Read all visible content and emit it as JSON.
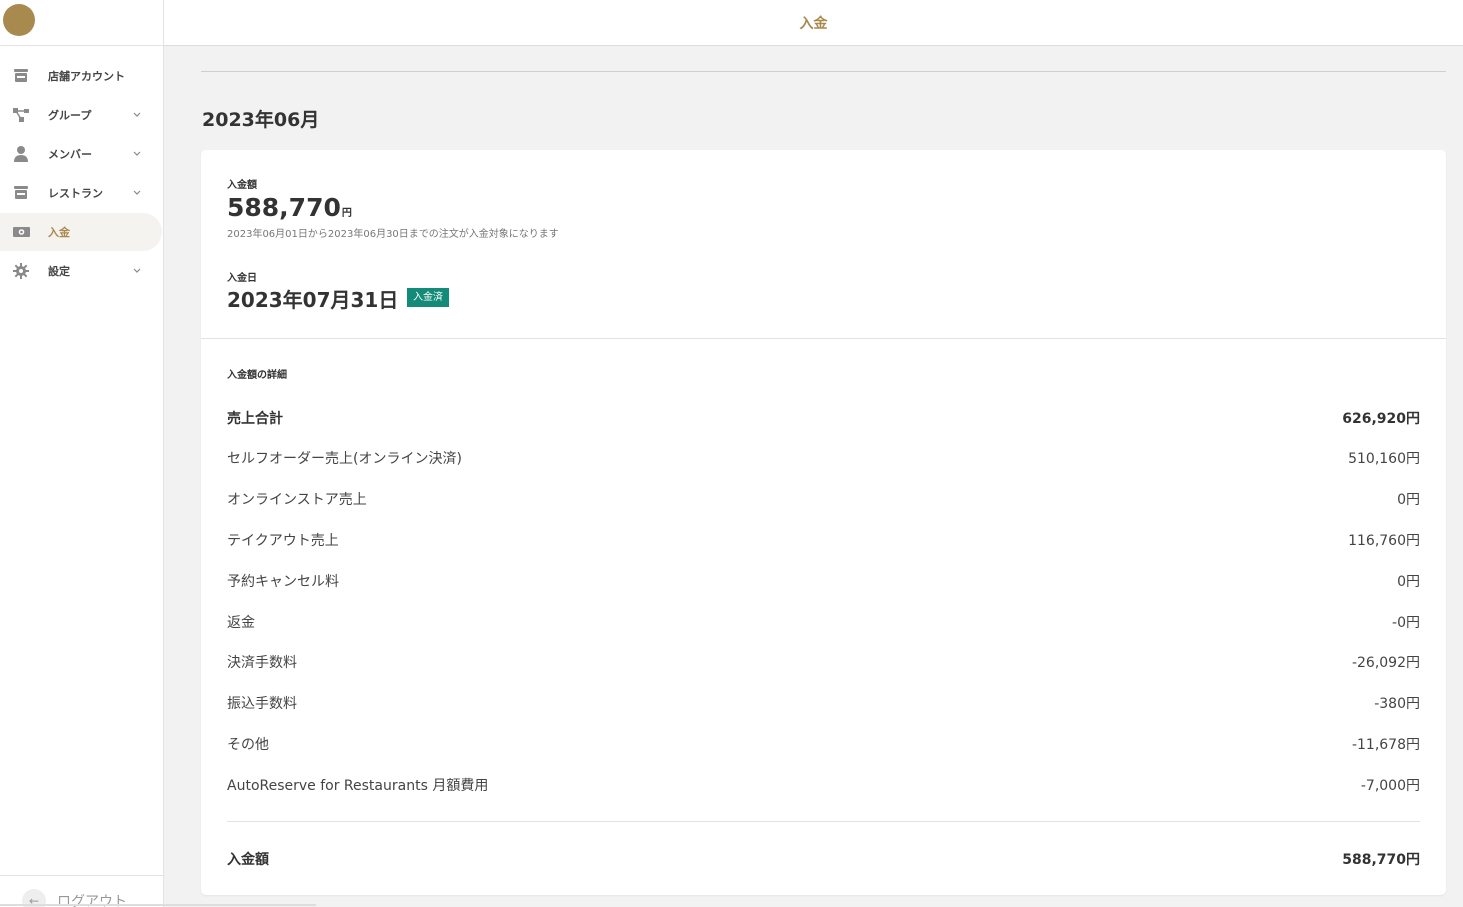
{
  "header": {
    "title": "入金"
  },
  "sidebar": {
    "items": [
      {
        "label": "店舗アカウント",
        "icon": "store-icon",
        "has_chevron": false,
        "active": false
      },
      {
        "label": "グループ",
        "icon": "group-icon",
        "has_chevron": true,
        "active": false
      },
      {
        "label": "メンバー",
        "icon": "person-icon",
        "has_chevron": true,
        "active": false
      },
      {
        "label": "レストラン",
        "icon": "store-icon",
        "has_chevron": true,
        "active": false
      },
      {
        "label": "入金",
        "icon": "money-icon",
        "has_chevron": false,
        "active": true
      },
      {
        "label": "設定",
        "icon": "gear-icon",
        "has_chevron": true,
        "active": false
      }
    ],
    "logout_label": "ログアウト"
  },
  "main": {
    "month_title": "2023年06月",
    "summary": {
      "amount_label": "入金額",
      "amount_value": "588,770",
      "amount_unit": "円",
      "amount_note": "2023年06月01日から2023年06月30日までの注文が入金対象になります",
      "date_label": "入金日",
      "date_value": "2023年07月31日",
      "status_badge": "入金済"
    },
    "details": {
      "title": "入金額の詳細",
      "rows": [
        {
          "label": "売上合計",
          "value": "626,920円",
          "bold": true
        },
        {
          "label": "セルフオーダー売上(オンライン決済)",
          "value": "510,160円",
          "bold": false
        },
        {
          "label": "オンラインストア売上",
          "value": "0円",
          "bold": false
        },
        {
          "label": "テイクアウト売上",
          "value": "116,760円",
          "bold": false
        },
        {
          "label": "予約キャンセル料",
          "value": "0円",
          "bold": false
        },
        {
          "label": "返金",
          "value": "-0円",
          "bold": false
        },
        {
          "label": "決済手数料",
          "value": "-26,092円",
          "bold": false
        },
        {
          "label": "振込手数料",
          "value": "-380円",
          "bold": false
        },
        {
          "label": "その他",
          "value": "-11,678円",
          "bold": false
        },
        {
          "label": "AutoReserve for Restaurants 月額費用",
          "value": "-7,000円",
          "bold": false
        }
      ],
      "total": {
        "label": "入金額",
        "value": "588,770円"
      }
    }
  },
  "colors": {
    "accent": "#a88a4f",
    "badge": "#148a78"
  }
}
